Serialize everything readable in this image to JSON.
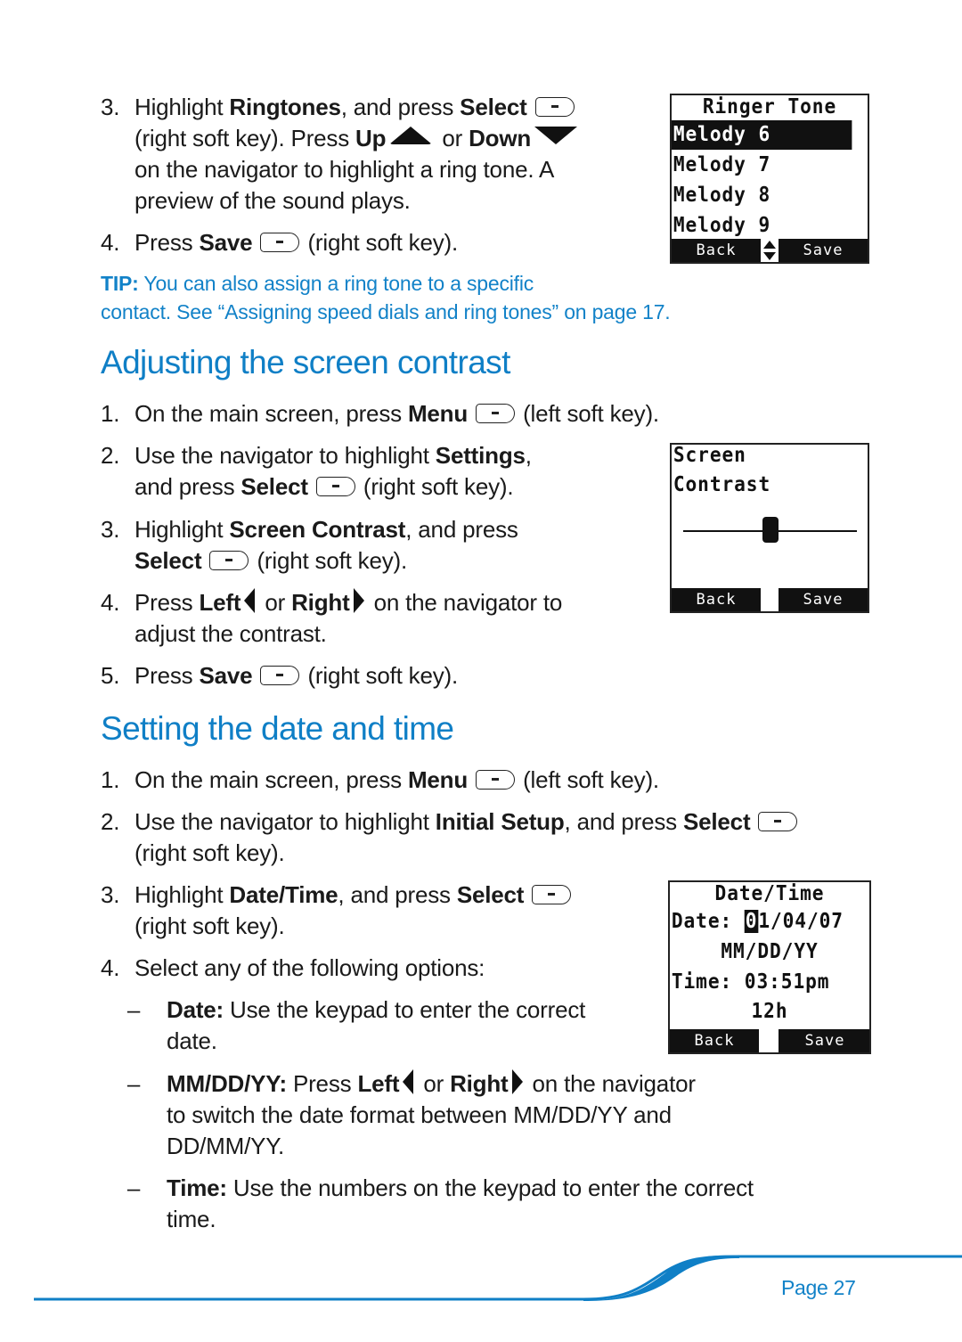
{
  "ringtones": {
    "step3": {
      "num": "3.",
      "t1": "Highlight ",
      "b1": "Ringtones",
      "t2": ", and press ",
      "b2": "Select",
      "t3": "(right soft key). Press ",
      "b3": "Up",
      "t4": " or ",
      "b4": "Down",
      "t5": "on the navigator to highlight a ring tone. A",
      "t6": "preview of the sound plays."
    },
    "step4": {
      "num": "4.",
      "t1": "Press ",
      "b1": "Save",
      "t2": " (right soft key)."
    },
    "tip": {
      "label": "TIP:",
      "line1": " You can also assign a ring tone to a specific",
      "line2": "contact. See “Assigning speed dials and ring tones” on page 17."
    },
    "screen": {
      "title": "Ringer Tone",
      "items": [
        "Melody 6",
        "Melody 7",
        "Melody 8",
        "Melody 9"
      ],
      "selected_index": 0,
      "left_soft": "Back",
      "right_soft": "Save"
    }
  },
  "contrast": {
    "heading": "Adjusting the screen contrast",
    "step1": {
      "num": "1.",
      "t1": "On the main screen, press ",
      "b1": "Menu",
      "t2": " (left soft key)."
    },
    "step2": {
      "num": "2.",
      "t1": "Use the navigator to highlight ",
      "b1": "Settings",
      "t2": ",",
      "t3": "and press ",
      "b2": "Select",
      "t4": " (right soft key)."
    },
    "step3": {
      "num": "3.",
      "t1": "Highlight ",
      "b1": "Screen Contrast",
      "t2": ", and press",
      "b2": "Select",
      "t3": " (right soft key)."
    },
    "step4": {
      "num": "4.",
      "t1": "Press ",
      "b1": "Left",
      "t2": " or ",
      "b2": "Right",
      "t3": " on the navigator to",
      "t4": "adjust the contrast."
    },
    "step5": {
      "num": "5.",
      "t1": "Press ",
      "b1": "Save",
      "t2": "  (right soft key)."
    },
    "screen": {
      "title": "Screen Contrast",
      "slider_level": 0.5,
      "left_soft": "Back",
      "right_soft": "Save"
    }
  },
  "datetime": {
    "heading": "Setting the date and time",
    "step1": {
      "num": "1.",
      "t1": "On the main screen, press ",
      "b1": "Menu",
      "t2": " (left soft key)."
    },
    "step2": {
      "num": "2.",
      "t1": "Use the navigator to highlight ",
      "b1": "Initial Setup",
      "t2": ", and press ",
      "b2": "Select",
      "t3": "(right soft key)."
    },
    "step3": {
      "num": "3.",
      "t1": "Highlight ",
      "b1": "Date/Time",
      "t2": ", and press ",
      "b2": "Select",
      "t3": "(right soft key)."
    },
    "step4": {
      "num": "4.",
      "t1": "Select any of the following options:"
    },
    "options": [
      {
        "dash": "–",
        "label": "Date:",
        "line1": " Use the keypad to enter the correct",
        "line2": "date."
      },
      {
        "dash": "–",
        "label": "MM/DD/YY:",
        "line1a": " Press ",
        "b1": "Left",
        "line1b": " or ",
        "b2": "Right",
        "line1c": " on the navigator",
        "line2": "to switch the date format between MM/DD/YY and",
        "line3": "DD/MM/YY."
      },
      {
        "dash": "–",
        "label": "Time:",
        "line1": " Use the numbers on the keypad to enter the correct",
        "line2": "time."
      }
    ],
    "screen": {
      "title": "Date/Time",
      "date_label": "Date: ",
      "date_cursor": "0",
      "date_rest": "1/04/07",
      "format": "MM/DD/YY",
      "time_label": "Time: ",
      "time_value": "03:51pm",
      "clock_mode": "12h",
      "left_soft": "Back",
      "right_soft": "Save"
    }
  },
  "footer": {
    "page_label": "Page 27"
  },
  "colors": {
    "accent": "#0f7fc6",
    "text": "#1a1a1a"
  }
}
